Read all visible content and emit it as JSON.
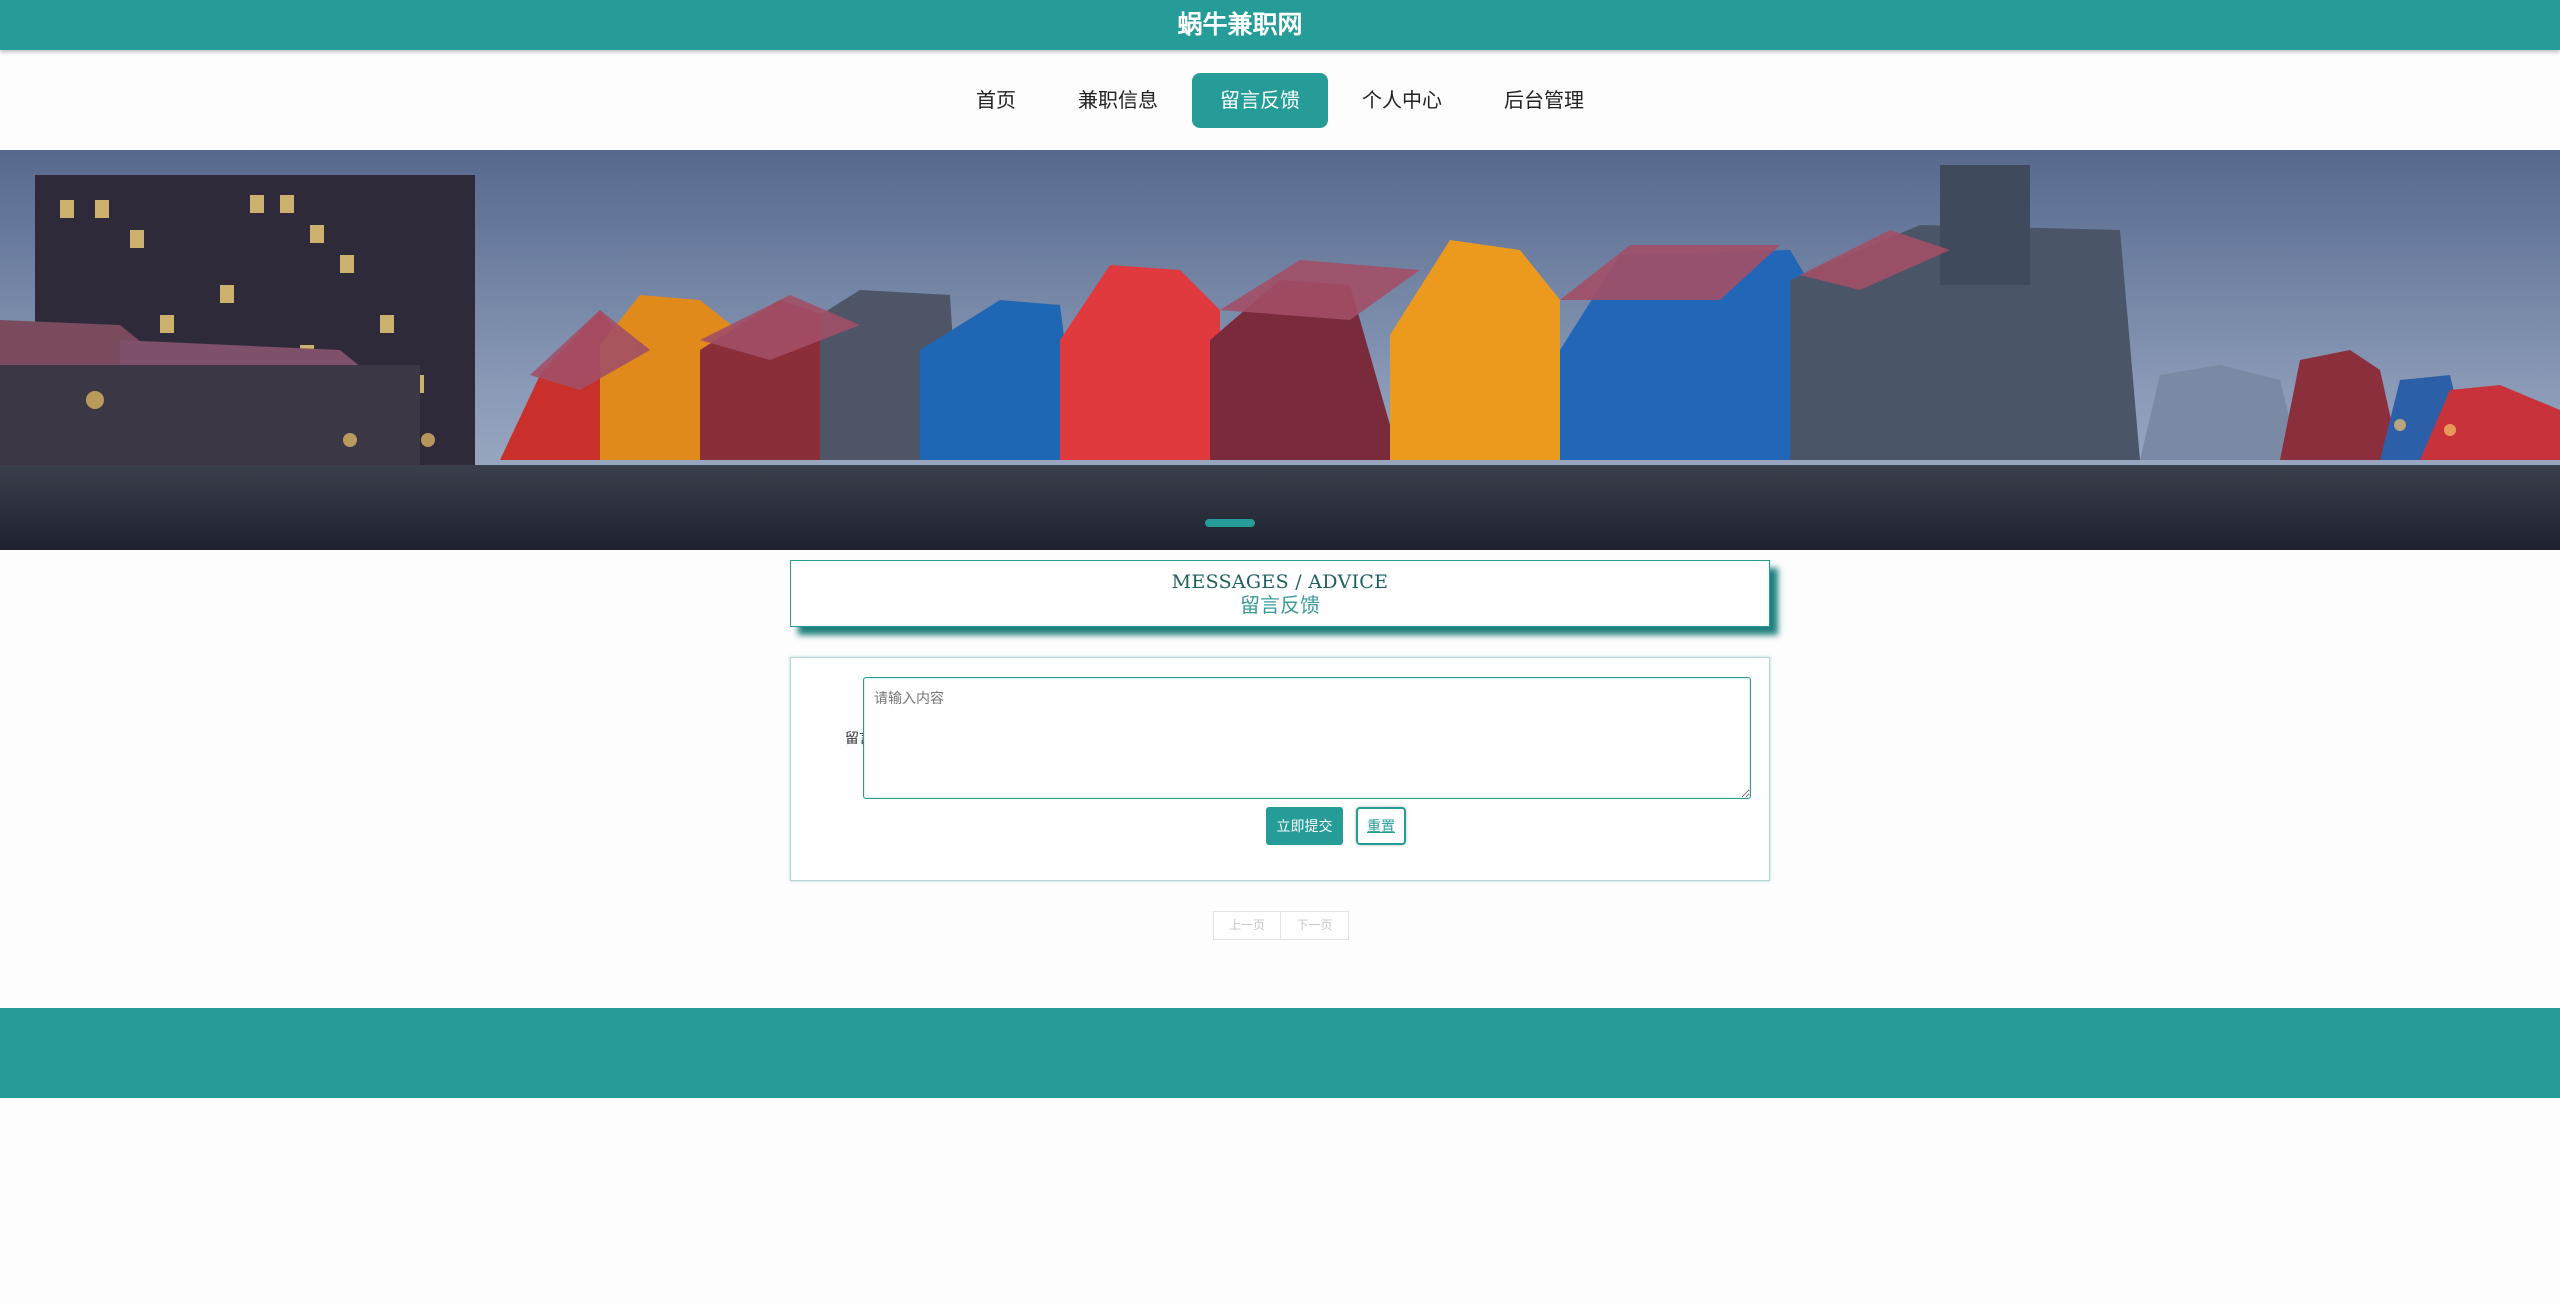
{
  "header": {
    "site_title": "蜗牛兼职网"
  },
  "nav": {
    "items": [
      {
        "label": "首页",
        "active": false
      },
      {
        "label": "兼职信息",
        "active": false
      },
      {
        "label": "留言反馈",
        "active": true
      },
      {
        "label": "个人中心",
        "active": false
      },
      {
        "label": "后台管理",
        "active": false
      }
    ]
  },
  "banner": {
    "slide_count": 3,
    "active_slide": 2
  },
  "section": {
    "title_en": "MESSAGES / ADVICE",
    "title_cn": "留言反馈"
  },
  "form": {
    "message_label": "留言",
    "message_value": "",
    "message_placeholder": "请输入内容",
    "submit_label": "立即提交",
    "reset_label": "重置"
  },
  "pagination": {
    "prev_label": "上一页",
    "next_label": "下一页"
  },
  "colors": {
    "accent": "#269c99",
    "page_bg": "#fdfdfd"
  }
}
